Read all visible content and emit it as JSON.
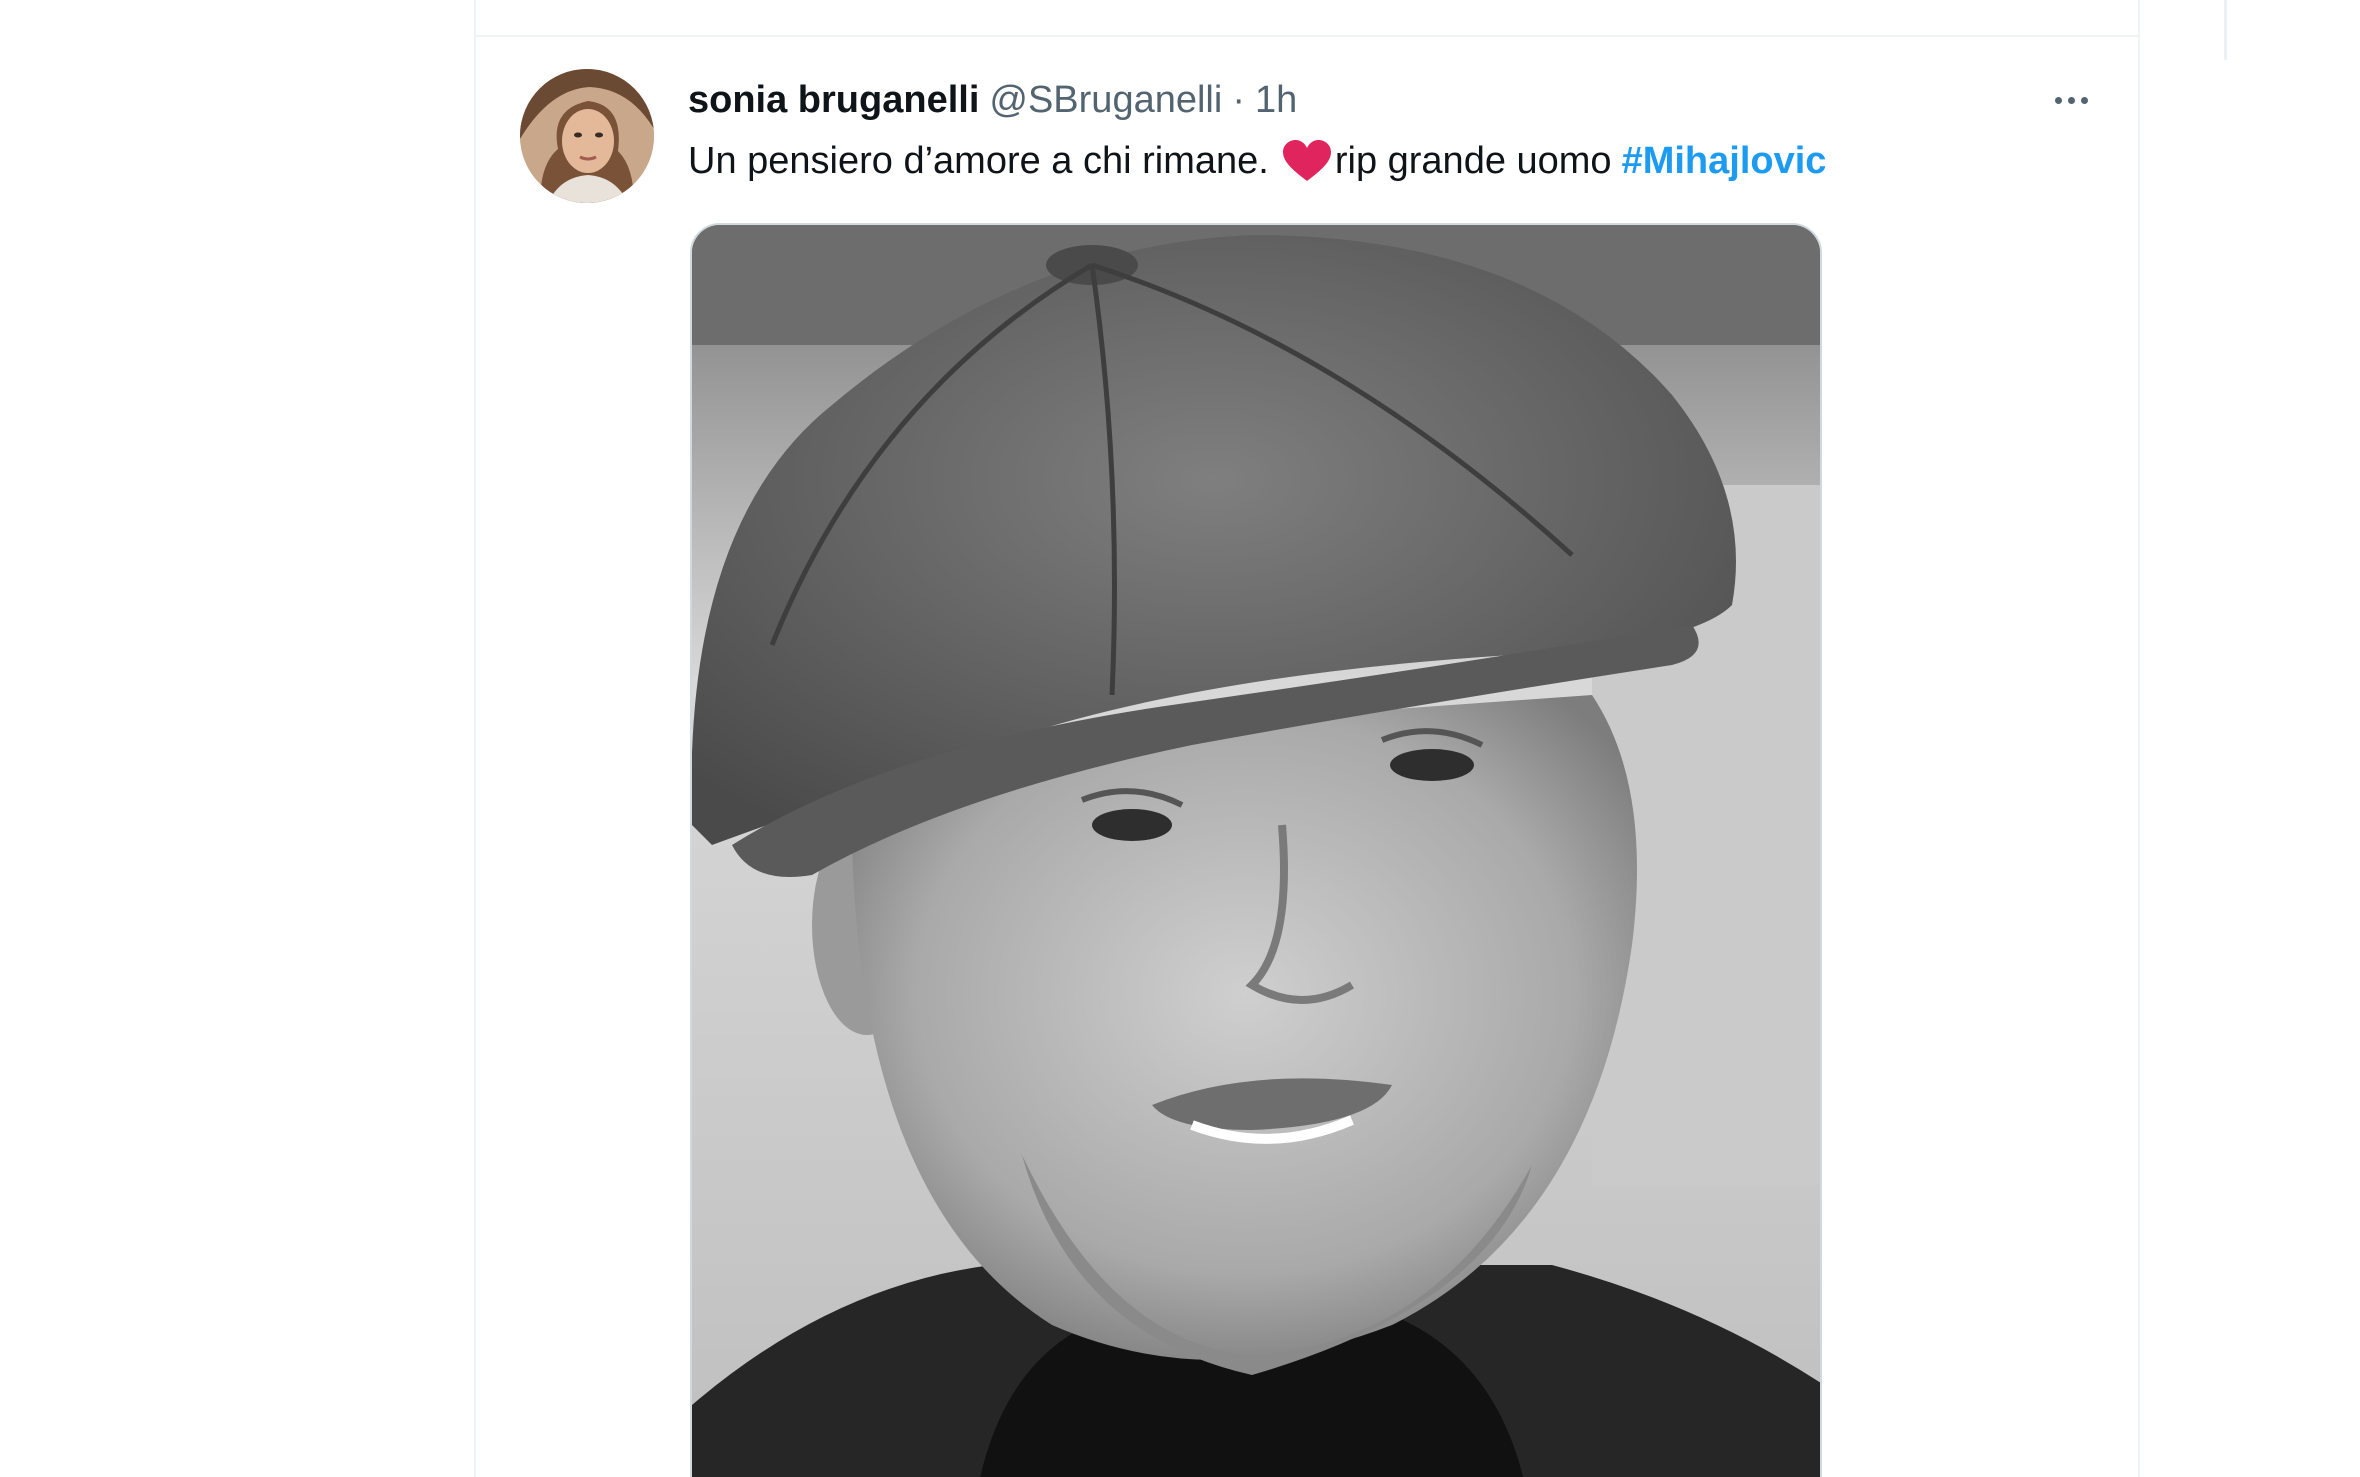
{
  "tweet": {
    "author": {
      "display_name": "sonia bruganelli",
      "handle": "@SBruganelli",
      "separator": "·",
      "timestamp": "1h",
      "avatar_icon": "user-avatar"
    },
    "text_before": "Un pensiero d’amore a chi rimane.",
    "emoji_icon": "red-heart-icon",
    "text_after": "rip grande uomo",
    "hashtag": "#Mihajlovic",
    "more_icon": "more-dots-icon",
    "media": {
      "type": "photo",
      "style": "black-and-white portrait"
    }
  },
  "colors": {
    "text_primary": "#0f1419",
    "text_secondary": "#536471",
    "link": "#1d9bf0",
    "border": "#eff3f4",
    "heart": "#e0245e"
  }
}
